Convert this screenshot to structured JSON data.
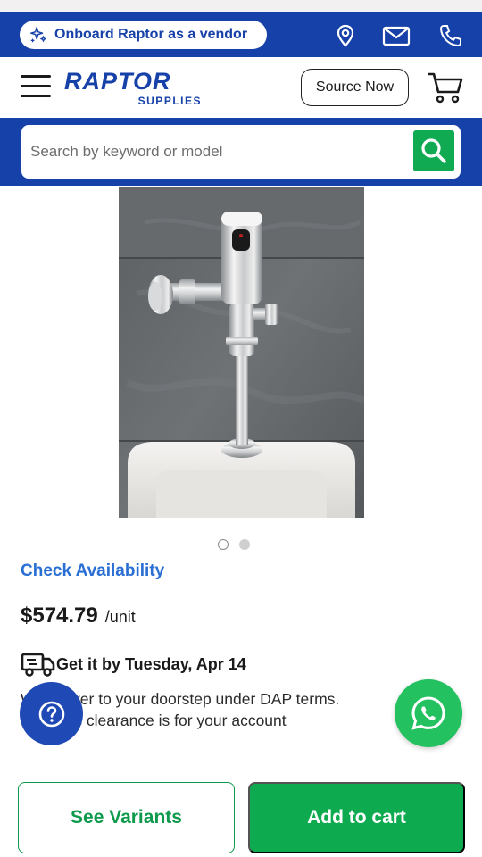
{
  "promo_bar": {
    "onboard_label": "Onboard Raptor as a vendor",
    "icons": [
      "sparkle-icon",
      "location-pin-icon",
      "mail-icon",
      "phone-icon"
    ],
    "background": "#1641a8"
  },
  "header": {
    "logo_main": "RAPTOR",
    "logo_sub": "SUPPLIES",
    "source_now_label": "Source Now",
    "menu_icon": "hamburger-icon",
    "cart_icon": "cart-icon"
  },
  "search": {
    "placeholder": "Search by keyword or model",
    "button_icon": "search-icon",
    "button_color": "#0faa52"
  },
  "gallery": {
    "image_name": "flush-valve-product-image",
    "dots_total": 2,
    "active_index": 1
  },
  "product": {
    "check_availability": "Check Availability",
    "price": "$574.79",
    "unit": "/unit",
    "delivery_title": "Get it by Tuesday, Apr 14",
    "deliver_line1": "We deliver to your doorstep under DAP terms.",
    "deliver_line2": "Customs clearance is for your account"
  },
  "floating": {
    "help_icon": "question-icon",
    "whatsapp_icon": "whatsapp-icon"
  },
  "actions": {
    "variants_label": "See Variants",
    "add_to_cart_label": "Add to cart",
    "accent": "#0eaa50"
  }
}
